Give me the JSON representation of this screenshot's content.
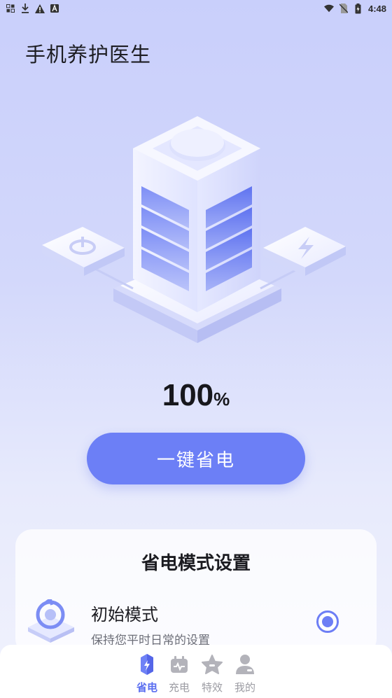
{
  "status_bar": {
    "time": "4:48",
    "left_icons": [
      "notification-grid-icon",
      "download-icon",
      "warning-icon",
      "keyboard-a-icon"
    ],
    "right_icons": [
      "wifi-icon",
      "no-sim-icon",
      "battery-icon"
    ]
  },
  "app": {
    "title": "手机养护医生"
  },
  "battery": {
    "percent_value": "100",
    "percent_unit": "%"
  },
  "actions": {
    "one_click_save": "一键省电"
  },
  "mode_settings": {
    "title": "省电模式设置",
    "modes": [
      {
        "name": "初始模式",
        "description": "保持您平时日常的设置",
        "selected": true
      }
    ]
  },
  "bottom_nav": {
    "items": [
      {
        "label": "省电",
        "icon": "battery-save-icon",
        "active": true
      },
      {
        "label": "充电",
        "icon": "charging-icon",
        "active": false
      },
      {
        "label": "特效",
        "icon": "effects-star-icon",
        "active": false
      },
      {
        "label": "我的",
        "icon": "profile-icon",
        "active": false
      }
    ]
  },
  "colors": {
    "accent": "#6c7ff6",
    "active_nav": "#5a6ef0",
    "inactive_nav": "#9c9ca3",
    "background_top": "#c9cffb",
    "background_bottom": "#f1f2fd"
  }
}
